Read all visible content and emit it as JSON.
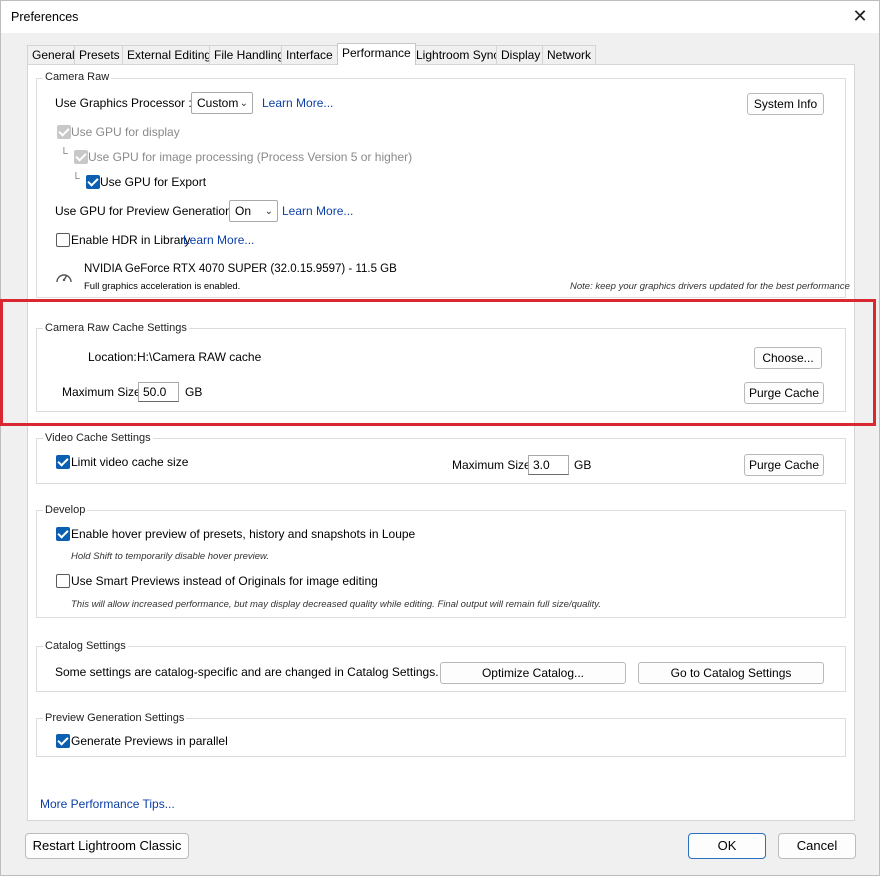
{
  "window": {
    "title": "Preferences",
    "close_glyph": "✕"
  },
  "tabs": [
    "General",
    "Presets",
    "External Editing",
    "File Handling",
    "Interface",
    "Performance",
    "Lightroom Sync",
    "Display",
    "Network"
  ],
  "active_tab": "Performance",
  "camera_raw": {
    "group_label": "Camera Raw",
    "graphics_processor_label": "Use Graphics Processor :",
    "graphics_processor_value": "Custom",
    "learn_more_1": "Learn More...",
    "system_info_button": "System Info",
    "gpu_display_label": "Use GPU for display",
    "gpu_image_processing_label": "Use GPU for image processing (Process Version 5 or higher)",
    "gpu_export_label": "Use GPU for Export",
    "gpu_preview_label": "Use GPU for Preview Generation :",
    "gpu_preview_value": "On",
    "learn_more_2": "Learn More...",
    "hdr_label": "Enable HDR in Library",
    "learn_more_3": "Learn More...",
    "gpu_name": "NVIDIA GeForce RTX 4070 SUPER (32.0.15.9597) - 11.5 GB",
    "gpu_status": "Full graphics acceleration is enabled.",
    "driver_note": "Note: keep your graphics drivers updated for the best performance"
  },
  "cache": {
    "group_label": "Camera Raw Cache Settings",
    "location_label": "Location:",
    "location_value": "H:\\Camera RAW cache",
    "choose_button": "Choose...",
    "max_size_label": "Maximum Size:",
    "max_size_value": "50.0",
    "unit": "GB",
    "purge_button": "Purge Cache"
  },
  "video_cache": {
    "group_label": "Video Cache Settings",
    "limit_label": "Limit video cache size",
    "max_size_label": "Maximum Size:",
    "max_size_value": "3.0",
    "unit": "GB",
    "purge_button": "Purge Cache"
  },
  "develop": {
    "group_label": "Develop",
    "hover_label": "Enable hover preview of presets, history and snapshots in Loupe",
    "hover_note": "Hold Shift to temporarily disable hover preview.",
    "smart_previews_label": "Use Smart Previews instead of Originals for image editing",
    "smart_previews_note": "This will allow increased performance, but may display decreased quality while editing. Final output will remain full size/quality."
  },
  "catalog": {
    "group_label": "Catalog Settings",
    "description": "Some settings are catalog-specific and are changed in Catalog Settings.",
    "optimize_button": "Optimize Catalog...",
    "goto_button": "Go to Catalog Settings"
  },
  "preview_gen": {
    "group_label": "Preview Generation Settings",
    "parallel_label": "Generate Previews in parallel"
  },
  "more_tips": "More Performance Tips...",
  "footer": {
    "restart_button": "Restart Lightroom Classic",
    "ok_button": "OK",
    "cancel_button": "Cancel"
  },
  "colors": {
    "link": "#0b3fa8",
    "checkbox_on": "#0a5fb0",
    "highlight": "#d9282f"
  },
  "icons": {
    "gauge": "gauge-icon",
    "tree_connector": "└"
  }
}
